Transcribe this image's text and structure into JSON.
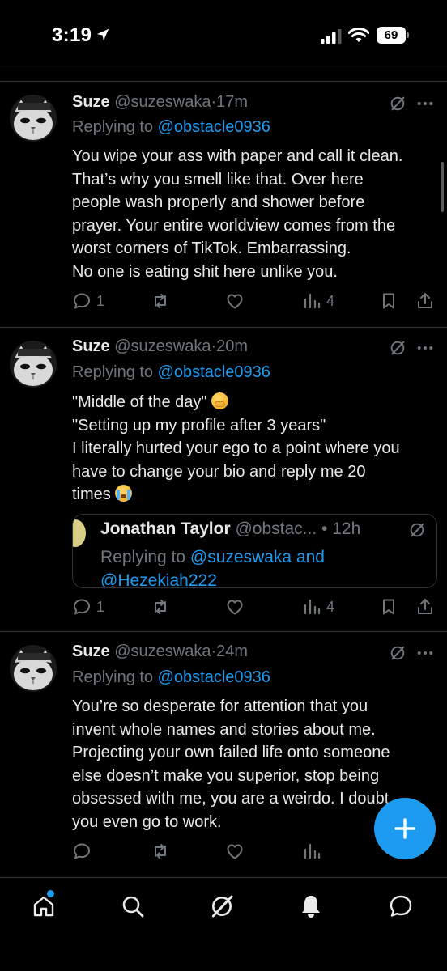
{
  "status_bar": {
    "time": "3:19",
    "battery": "69"
  },
  "tweets": [
    {
      "name": "Suze",
      "handle": "@suzeswaka",
      "dot": "·",
      "time": "17m",
      "replying_prefix": "Replying to",
      "replying_to": "@obstacle0936",
      "body_lines": [
        "You wipe your ass with paper and call it clean.",
        "That’s why you smell like that. Over here",
        "people wash properly and shower before",
        "prayer. Your entire worldview comes from the",
        "worst corners of TikTok. Embarrassing.",
        "No one is eating shit here unlike you."
      ],
      "reply_count": "1",
      "retweet_count": "",
      "like_count": "",
      "view_count": "4"
    },
    {
      "name": "Suze",
      "handle": "@suzeswaka",
      "dot": "·",
      "time": "20m",
      "replying_prefix": "Replying to",
      "replying_to": "@obstacle0936",
      "body_lines": [
        "\"Middle of the day\"",
        "\"Setting up my profile after 3 years\"",
        "I literally hurted your ego to a point where you",
        "have to change your bio and reply me 20",
        "times"
      ],
      "quoted": {
        "name": "Jonathan Taylor",
        "handle": "@obstac...",
        "dot": "•",
        "time": "12h",
        "replying_prefix": "Replying to",
        "replying_to_1": "@suzeswaka",
        "and": "and",
        "replying_to_2": "@Hezekiah222"
      },
      "reply_count": "1",
      "retweet_count": "",
      "like_count": "",
      "view_count": "4"
    },
    {
      "name": "Suze",
      "handle": "@suzeswaka",
      "dot": "·",
      "time": "24m",
      "replying_prefix": "Replying to",
      "replying_to": "@obstacle0936",
      "body_lines": [
        "You’re so desperate for attention that you",
        "invent whole names and stories about me.",
        "Projecting your own failed life onto someone",
        "else doesn’t make you superior, stop being",
        "obsessed with me, you are a weirdo. I doubt",
        "you even go to work."
      ],
      "reply_count": "",
      "retweet_count": "",
      "like_count": "",
      "view_count": ""
    }
  ],
  "icons": {
    "status": [
      "location-arrow-icon",
      "cellular-signal-icon",
      "wifi-icon",
      "battery-icon"
    ],
    "tweet": [
      "grok-icon",
      "more-icon",
      "reply-icon",
      "retweet-icon",
      "like-icon",
      "views-icon",
      "bookmark-icon",
      "share-icon"
    ],
    "nav": [
      "home-icon",
      "search-icon",
      "grok-icon",
      "notifications-icon",
      "messages-icon"
    ],
    "fab": "plus-icon"
  },
  "colors": {
    "background": "#000000",
    "text": "#e7e9ea",
    "muted": "#71767b",
    "accent": "#1d9bf0",
    "divider": "#2f3336"
  }
}
